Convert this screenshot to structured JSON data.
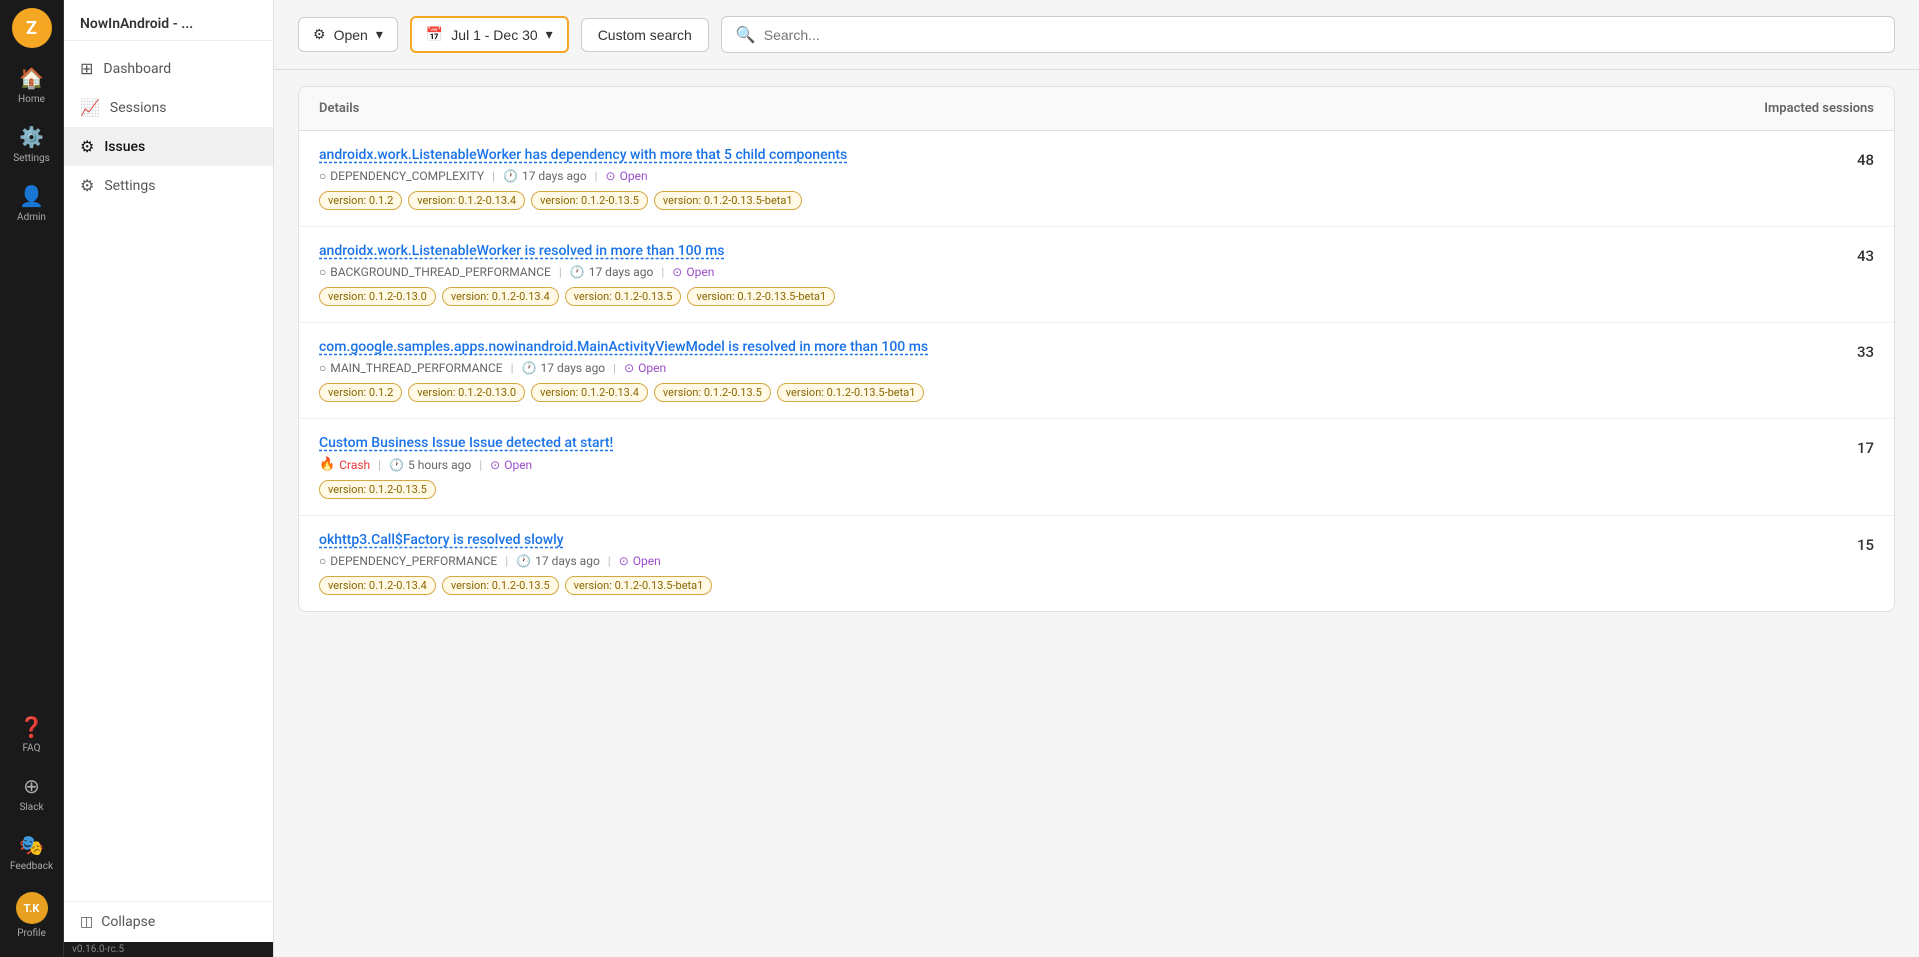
{
  "app": {
    "logo": "Z",
    "version": "v0.16.0-rc.5"
  },
  "nav": {
    "items": [
      {
        "id": "home",
        "label": "Home",
        "icon": "🏠"
      },
      {
        "id": "settings",
        "label": "Settings",
        "icon": "⚙️"
      },
      {
        "id": "admin",
        "label": "Admin",
        "icon": "👤"
      },
      {
        "id": "faq",
        "label": "FAQ",
        "icon": "❓"
      },
      {
        "id": "slack",
        "label": "Slack",
        "icon": "💬"
      },
      {
        "id": "feedback",
        "label": "Feedback",
        "icon": "🎭"
      },
      {
        "id": "profile",
        "label": "Profile",
        "icon": "👤"
      }
    ]
  },
  "sidebar": {
    "title": "NowInAndroid - ...",
    "menu_items": [
      {
        "id": "dashboard",
        "label": "Dashboard",
        "icon": "⊞",
        "active": false
      },
      {
        "id": "sessions",
        "label": "Sessions",
        "icon": "📈",
        "active": false
      },
      {
        "id": "issues",
        "label": "Issues",
        "icon": "⚙",
        "active": true
      },
      {
        "id": "settings",
        "label": "Settings",
        "icon": "⚙",
        "active": false
      }
    ],
    "collapse_label": "Collapse"
  },
  "toolbar": {
    "filter_label": "Open",
    "date_label": "Jul 1 - Dec 30",
    "custom_search_label": "Custom search",
    "search_placeholder": "Search..."
  },
  "table": {
    "col_details": "Details",
    "col_impacted": "Impacted sessions",
    "issues": [
      {
        "id": 1,
        "title": "androidx.work.ListenableWorker has dependency with more that 5 child components",
        "type": "DEPENDENCY_COMPLEXITY",
        "type_icon": "○",
        "time": "17 days ago",
        "status": "Open",
        "count": "48",
        "versions": [
          "version: 0.1.2",
          "version: 0.1.2-0.13.4",
          "version: 0.1.2-0.13.5",
          "version: 0.1.2-0.13.5-beta1"
        ]
      },
      {
        "id": 2,
        "title": "androidx.work.ListenableWorker is resolved in more than 100 ms",
        "type": "BACKGROUND_THREAD_PERFORMANCE",
        "type_icon": "○",
        "time": "17 days ago",
        "status": "Open",
        "count": "43",
        "versions": [
          "version: 0.1.2-0.13.0",
          "version: 0.1.2-0.13.4",
          "version: 0.1.2-0.13.5",
          "version: 0.1.2-0.13.5-beta1"
        ]
      },
      {
        "id": 3,
        "title": "com.google.samples.apps.nowinandroid.MainActivityViewModel is resolved in more than 100 ms",
        "type": "MAIN_THREAD_PERFORMANCE",
        "type_icon": "○",
        "time": "17 days ago",
        "status": "Open",
        "count": "33",
        "versions": [
          "version: 0.1.2",
          "version: 0.1.2-0.13.0",
          "version: 0.1.2-0.13.4",
          "version: 0.1.2-0.13.5",
          "version: 0.1.2-0.13.5-beta1"
        ]
      },
      {
        "id": 4,
        "title": "Custom Business Issue Issue detected at start!",
        "type": "Crash",
        "type_icon": "🔥",
        "time": "5 hours ago",
        "status": "Open",
        "count": "17",
        "versions": [
          "version: 0.1.2-0.13.5"
        ],
        "is_crash": true
      },
      {
        "id": 5,
        "title": "okhttp3.Call$Factory is resolved slowly",
        "type": "DEPENDENCY_PERFORMANCE",
        "type_icon": "○",
        "time": "17 days ago",
        "status": "Open",
        "count": "15",
        "versions": [
          "version: 0.1.2-0.13.4",
          "version: 0.1.2-0.13.5",
          "version: 0.1.2-0.13.5-beta1"
        ]
      }
    ]
  },
  "profile": {
    "initials": "T.K"
  }
}
